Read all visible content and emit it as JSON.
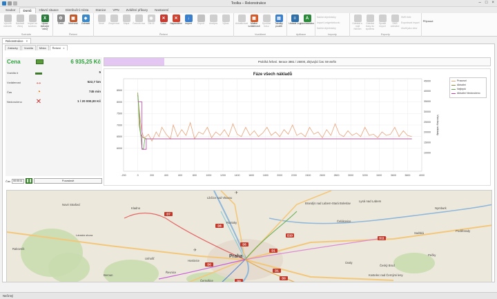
{
  "app": {
    "title": "Toolka – Rekonstrukce"
  },
  "ribbon_tabs": [
    "Soubor",
    "Domů",
    "Hlavní situace",
    "Distribuční místa",
    "Stanice",
    "VPN",
    "Zvláštní příkazy",
    "Nastavení"
  ],
  "ribbon_active_tab": 1,
  "ribbon_groups": [
    {
      "label": "Scénáře",
      "buttons": [
        {
          "label": "Vytvořit nálezek",
          "icon": "document-icon",
          "color": "#8f8f8f",
          "disabled": true
        },
        {
          "label": "Nastavit Zdroj",
          "icon": "folder-icon",
          "color": "#8f8f8f",
          "disabled": true
        },
        {
          "label": "Import ze souboru",
          "icon": "import-icon",
          "color": "#8f8f8f",
          "disabled": true
        },
        {
          "label": "Uprav stávající \"zdroj\"",
          "icon": "excel-icon",
          "color": "#2a7a3b",
          "disabled": false
        }
      ]
    },
    {
      "label": "Řešení",
      "buttons": [
        {
          "label": "Řešit",
          "icon": "gear-icon",
          "color": "#8a8a8a",
          "disabled": false
        },
        {
          "label": "Možnosti",
          "icon": "options-icon",
          "color": "#c0582b",
          "disabled": false
        },
        {
          "label": "Zobrazit",
          "icon": "view-icon",
          "color": "#3b88c8",
          "disabled": false
        }
      ]
    },
    {
      "label": "Řešení",
      "buttons": [
        {
          "label": "Nové",
          "icon": "new-icon",
          "color": "#9a9a9a",
          "disabled": true
        },
        {
          "label": "Zkopírovat",
          "icon": "copy-icon",
          "color": "#9a9a9a",
          "disabled": true
        },
        {
          "label": "Mapa",
          "icon": "map-icon",
          "color": "#9a9a9a",
          "disabled": true
        },
        {
          "label": "Časová osa",
          "icon": "timeline-icon",
          "color": "#9a9a9a",
          "disabled": true
        },
        {
          "label": "Dle-M",
          "icon": "eye-icon",
          "color": "#9a9a9a",
          "disabled": true
        },
        {
          "label": "Odstr.",
          "icon": "delete-doc-icon",
          "color": "#c83a2f",
          "disabled": false
        },
        {
          "label": "Napouštění",
          "icon": "close-icon",
          "color": "#d0402f",
          "disabled": false
        },
        {
          "label": "Import",
          "icon": "import-blue-icon",
          "color": "#3b7fcc",
          "disabled": false
        },
        {
          "label": "Export",
          "icon": "export-icon",
          "color": "#7a7a7a",
          "disabled": true
        },
        {
          "label": "Analýza",
          "icon": "analysis-icon",
          "color": "#9a9a9a",
          "disabled": true
        },
        {
          "label": "Výkaz",
          "icon": "report-icon",
          "color": "#9a9a9a",
          "disabled": true
        }
      ]
    },
    {
      "label": "Vozidlemi",
      "buttons": [
        {
          "label": "Aktualizovat",
          "icon": "refresh-icon",
          "color": "#9a9a9a",
          "disabled": true
        },
        {
          "label": "Matice vzdáleností",
          "icon": "matrix-icon",
          "color": "#d25b2b",
          "disabled": false
        },
        {
          "label": "Spočítat trasu",
          "icon": "route-icon",
          "color": "#9a9a9a",
          "disabled": true
        },
        {
          "label": "Tabulky použití",
          "icon": "table-icon",
          "color": "#3b7fcc",
          "disabled": false
        }
      ]
    },
    {
      "label": "Aplikace",
      "buttons": [
        {
          "label": "Ukázat Log",
          "icon": "log-icon",
          "color": "#2f6fa8",
          "disabled": false
        },
        {
          "label": "Administrátor",
          "icon": "admin-icon",
          "color": "#2a8a3a",
          "disabled": false
        }
      ]
    }
  ],
  "import_group": {
    "label": "Importy",
    "items": [
      "Načíst objednávky",
      "Import Ledgerkinkoviu",
      "Načíst objednávky"
    ]
  },
  "export_group": {
    "label": "Exporty",
    "buttons": [
      {
        "label": "Odeslat e-mail řidičům",
        "icon": "mail-icon"
      },
      {
        "label": "Odeslat trasy do systému",
        "icon": "send-icon"
      },
      {
        "label": "Spustit import",
        "icon": "run-import-icon"
      },
      {
        "label": "SMS odeslání",
        "icon": "sms-icon"
      }
    ],
    "items": [
      "SMS řidič",
      "Exportovat import",
      "Uložit jako view"
    ]
  },
  "pin_label": "Připnout",
  "doc_tab": {
    "label": "Rekonstrukce",
    "close": "×"
  },
  "subtabs": [
    {
      "label": "Zakázky",
      "active": false
    },
    {
      "label": "Vozidla",
      "active": false
    },
    {
      "label": "Místa",
      "active": false
    },
    {
      "label": "Řešení",
      "active": true,
      "close": "×"
    }
  ],
  "stats": {
    "title": "Cena",
    "price": "6 935,25 Kč",
    "rows": [
      {
        "label": "Vozidla #",
        "icon": "truck-icon",
        "color": "#3c7a2a",
        "value": "5"
      },
      {
        "label": "Vzdálenost",
        "icon": "distance-icon",
        "color": "#d9342b",
        "value": "522,7 km"
      },
      {
        "label": "Čas",
        "icon": "clock-icon",
        "color": "#e0811c",
        "value": "745 min"
      },
      {
        "label": "Nedoručeno",
        "icon": "undelivered-icon",
        "color": "#c8302a",
        "value": "1 / 20 000,00 Kč"
      }
    ]
  },
  "timebar": {
    "label": "Čas",
    "value": "00:00:11",
    "pause_icon": "pause-icon",
    "stop_label": "Pozastavit"
  },
  "progress": {
    "fraction": 0.155,
    "text": "Probíhá řešení. Iterace 3861 / 25000, Zbývající čas: 59 vteřin"
  },
  "chart_data": {
    "type": "line",
    "title": "Fáze všech nákladů",
    "ylabel_right": "Všechny náklady",
    "xlim": [
      -200,
      4000
    ],
    "ylim_left": [
      5000,
      9000
    ],
    "ylim_right": [
      1000,
      46000
    ],
    "x_ticks": [
      -200,
      0,
      200,
      400,
      600,
      800,
      1000,
      1200,
      1400,
      1600,
      1800,
      2000,
      2200,
      2400,
      2600,
      2800,
      3000,
      3200,
      3400,
      3600,
      3800,
      4000
    ],
    "y_ticks_left": [
      6000,
      6500,
      7000,
      7500,
      8000,
      8500
    ],
    "y_ticks_right": [
      10000,
      15000,
      20000,
      25000,
      30000,
      35000,
      40000,
      45000
    ],
    "legend_position": "top-right",
    "series": [
      {
        "name": "Pracovní",
        "color": "#e8a27a",
        "x": [
          0,
          10,
          20,
          40,
          60,
          80,
          100,
          150,
          200,
          260,
          300,
          340,
          400,
          460,
          500,
          560,
          620,
          680,
          740,
          800,
          860,
          920,
          980,
          1040,
          1100,
          1160,
          1220,
          1280,
          1340,
          1400,
          1460,
          1520,
          1580,
          1640,
          1700,
          1760,
          1820,
          1880,
          1940,
          2000,
          2060,
          2120,
          2180,
          2240,
          2300,
          2360,
          2420,
          2480,
          2540,
          2600,
          2660,
          2720,
          2780,
          2840,
          2900,
          2960,
          3020,
          3080,
          3140,
          3200,
          3260,
          3320,
          3380,
          3440,
          3500,
          3560,
          3620,
          3680,
          3740,
          3800,
          3860
        ],
        "y": [
          8300,
          8000,
          7700,
          7100,
          6700,
          6500,
          6450,
          6600,
          6300,
          6700,
          6500,
          6900,
          6600,
          6400,
          7000,
          6500,
          6800,
          6550,
          7100,
          6400,
          6700,
          6600,
          6900,
          6450,
          6700,
          6550,
          6800,
          6500,
          7050,
          6600,
          6500,
          6900,
          6550,
          6750,
          6500,
          6650,
          6900,
          6550,
          6700,
          6500,
          6800,
          6600,
          7000,
          6550,
          6650,
          6500,
          6900,
          6600,
          6700,
          6450,
          6800,
          6550,
          7050,
          6600,
          6500,
          6750,
          6550,
          6650,
          6500,
          6900,
          6550,
          6600,
          6450,
          6700,
          6550,
          6600,
          6900,
          6500,
          6750,
          6550,
          6500
        ]
      },
      {
        "name": "Aktuální",
        "color": "#8a8a3a",
        "x": [
          0,
          10,
          20,
          40,
          60,
          80,
          100,
          120,
          140,
          200,
          300,
          400,
          600,
          800,
          1000,
          1400,
          1800,
          2200,
          2600,
          3000,
          3400,
          3800,
          3860
        ],
        "y": [
          8400,
          7900,
          7000,
          6600,
          6500,
          6450,
          6420,
          6410,
          6400,
          6400,
          6400,
          6400,
          6400,
          6400,
          6400,
          6400,
          6400,
          6400,
          6400,
          6400,
          6400,
          6400,
          6400
        ]
      },
      {
        "name": "Nejlepší",
        "color": "#5aa84a",
        "x": [
          0,
          20,
          40,
          60,
          80,
          100,
          140,
          200,
          300,
          500,
          1000,
          2000,
          3000,
          3860
        ],
        "y": [
          8300,
          7500,
          6600,
          6000,
          5950,
          6400,
          6400,
          6400,
          6400,
          6400,
          6400,
          6400,
          6400,
          6400
        ]
      },
      {
        "name": "Aktuální Nedoručeno",
        "color": "#c23aa8",
        "x": [
          0,
          40,
          60,
          60,
          120,
          120,
          200,
          600,
          1000,
          2000,
          3000,
          3860
        ],
        "y": [
          8000,
          8000,
          8000,
          5950,
          5950,
          6400,
          6400,
          6400,
          6400,
          6400,
          6400,
          6400
        ]
      }
    ]
  },
  "map": {
    "places": [
      {
        "name": "Libčice nad Vltavou"
      },
      {
        "name": "Nové Strašecí"
      },
      {
        "name": "Kladno"
      },
      {
        "name": "Rakovník"
      },
      {
        "name": "Lánská obora"
      },
      {
        "name": "Unhošť"
      },
      {
        "name": "Hostivice"
      },
      {
        "name": "Roztoky"
      },
      {
        "name": "Praha"
      },
      {
        "name": "Brandýs nad Labem-Stará Boleslav"
      },
      {
        "name": "Lysá nad Labem"
      },
      {
        "name": "Čelákovice"
      },
      {
        "name": "Nymburk"
      },
      {
        "name": "Sadská"
      },
      {
        "name": "Poděbrady"
      },
      {
        "name": "Úvaly"
      },
      {
        "name": "Český Brod"
      },
      {
        "name": "Pečky"
      },
      {
        "name": "Beroun"
      },
      {
        "name": "CHKO Křivoklátsko"
      },
      {
        "name": "CHKO Český kras"
      },
      {
        "name": "Černošice"
      },
      {
        "name": "Kostelec nad Černými lesy"
      },
      {
        "name": "Králův Dvůr"
      },
      {
        "name": "Řevnice"
      }
    ],
    "route_labels": [
      "D7",
      "D8",
      "D10",
      "D11",
      "D0",
      "D1",
      "D5",
      "D0",
      "D1",
      "D0"
    ]
  },
  "status": {
    "text": "Nečinný"
  }
}
